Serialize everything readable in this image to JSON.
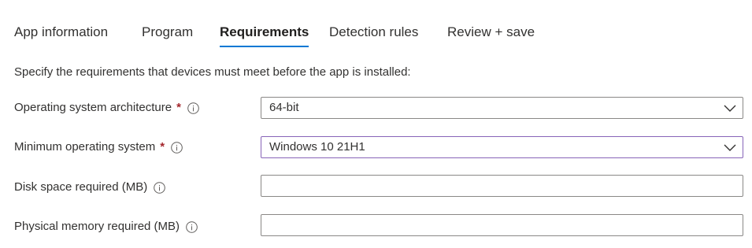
{
  "tabs": [
    {
      "label": "App information"
    },
    {
      "label": "Program"
    },
    {
      "label": "Requirements"
    },
    {
      "label": "Detection rules"
    },
    {
      "label": "Review + save"
    }
  ],
  "active_tab": "Requirements",
  "intro": "Specify the requirements that devices must meet before the app is installed:",
  "fields": {
    "os_architecture": {
      "label": "Operating system architecture",
      "required_mark": "*",
      "value": "64-bit"
    },
    "min_os": {
      "label": "Minimum operating system",
      "required_mark": "*",
      "value": "Windows 10 21H1"
    },
    "disk_space": {
      "label": "Disk space required (MB)",
      "value": "",
      "placeholder": ""
    },
    "physical_memory": {
      "label": "Physical memory required (MB)",
      "value": "",
      "placeholder": ""
    }
  },
  "colors": {
    "accent": "#0078d4",
    "required": "#a4262c",
    "focus_border": "#8764b8",
    "border": "#8a8886",
    "text": "#323130"
  },
  "icons": {
    "info": "info-circle-icon",
    "dropdown": "chevron-down-icon"
  }
}
